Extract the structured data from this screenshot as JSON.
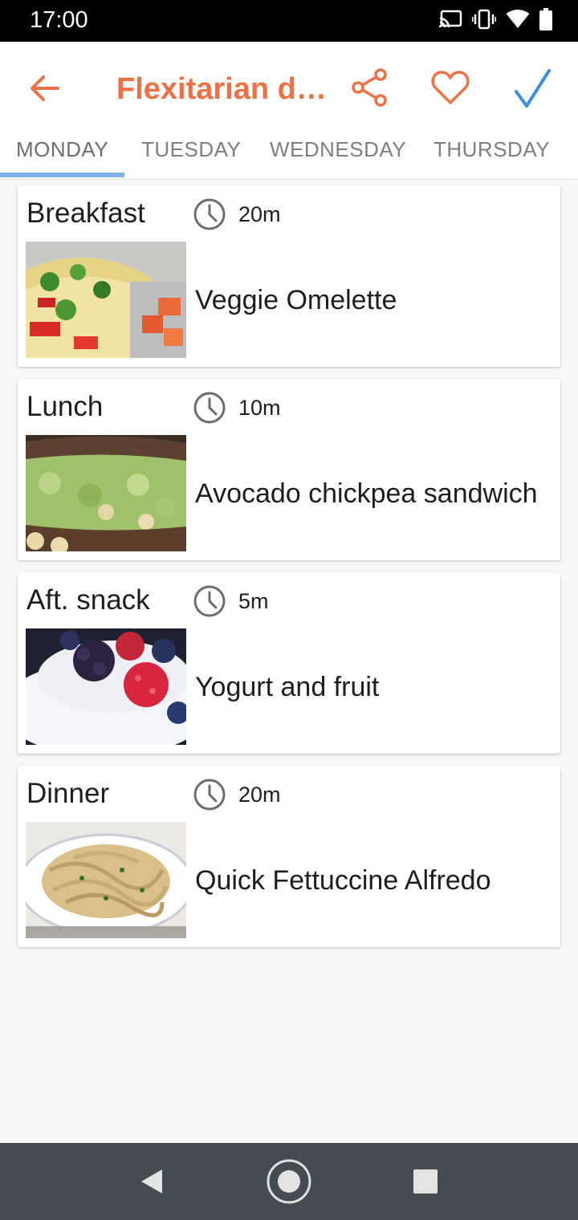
{
  "status_bar": {
    "time": "17:00",
    "icons": [
      "cast-icon",
      "vibrate-icon",
      "wifi-icon",
      "battery-icon"
    ]
  },
  "header": {
    "title": "Flexitarian di…",
    "back_icon": "arrow-left-icon",
    "actions": [
      "share-icon",
      "heart-icon",
      "check-icon"
    ]
  },
  "tabs": [
    {
      "label": "MONDAY",
      "active": true
    },
    {
      "label": "TUESDAY",
      "active": false
    },
    {
      "label": "WEDNESDAY",
      "active": false
    },
    {
      "label": "THURSDAY",
      "active": false
    }
  ],
  "meals": [
    {
      "type": "Breakfast",
      "time": "20m",
      "recipe": "Veggie Omelette",
      "photo": "omelette-photo"
    },
    {
      "type": "Lunch",
      "time": "10m",
      "recipe": "Avocado chickpea sandwich",
      "photo": "sandwich-photo"
    },
    {
      "type": "Aft. snack",
      "time": "5m",
      "recipe": "Yogurt and fruit",
      "photo": "yogurt-photo"
    },
    {
      "type": "Dinner",
      "time": "20m",
      "recipe": "Quick Fettuccine Alfredo",
      "photo": "pasta-photo"
    }
  ],
  "colors": {
    "accent_orange": "#ee7145",
    "check_blue": "#3b8fdb",
    "tab_indicator": "#7eb5e6",
    "nav_bar": "#454b52"
  },
  "nav_bar": {
    "buttons": [
      "back-triangle-icon",
      "home-circle-icon",
      "recents-square-icon"
    ]
  }
}
